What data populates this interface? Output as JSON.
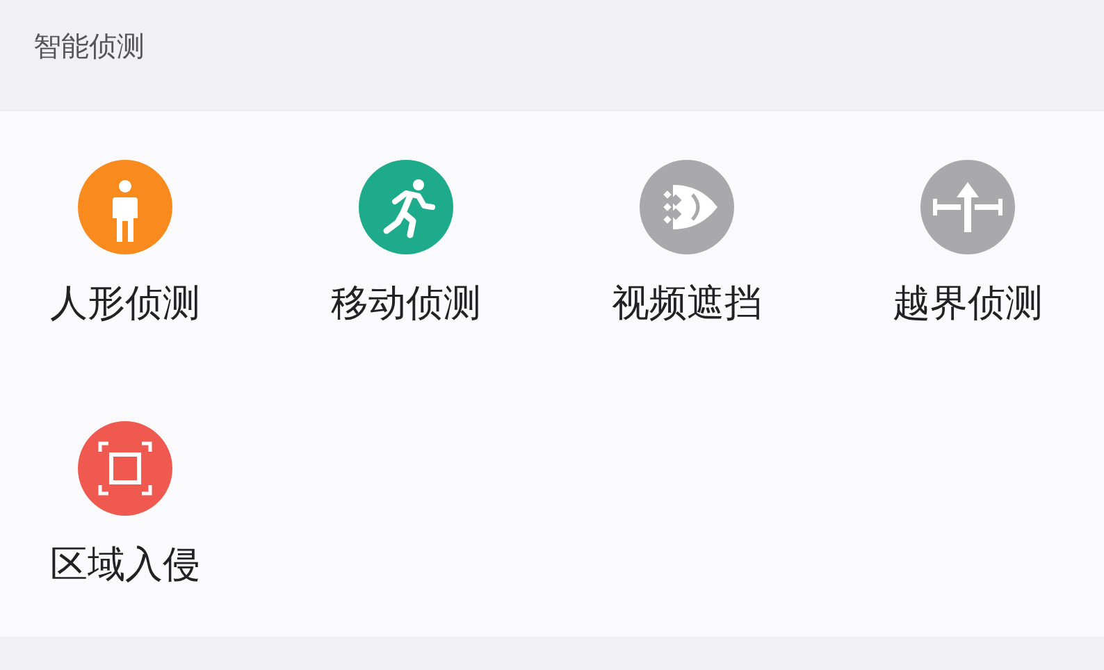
{
  "section": {
    "title": "智能侦测"
  },
  "items": [
    {
      "label": "人形侦测",
      "kind": "person",
      "color": "#f98b1e"
    },
    {
      "label": "移动侦测",
      "kind": "runner",
      "color": "#1eab8c"
    },
    {
      "label": "视频遮挡",
      "kind": "occlusion",
      "color": "#a9a9ab"
    },
    {
      "label": "越界侦测",
      "kind": "line-cross",
      "color": "#a9a9ab"
    },
    {
      "label": "区域入侵",
      "kind": "region",
      "color": "#f0594f"
    }
  ]
}
